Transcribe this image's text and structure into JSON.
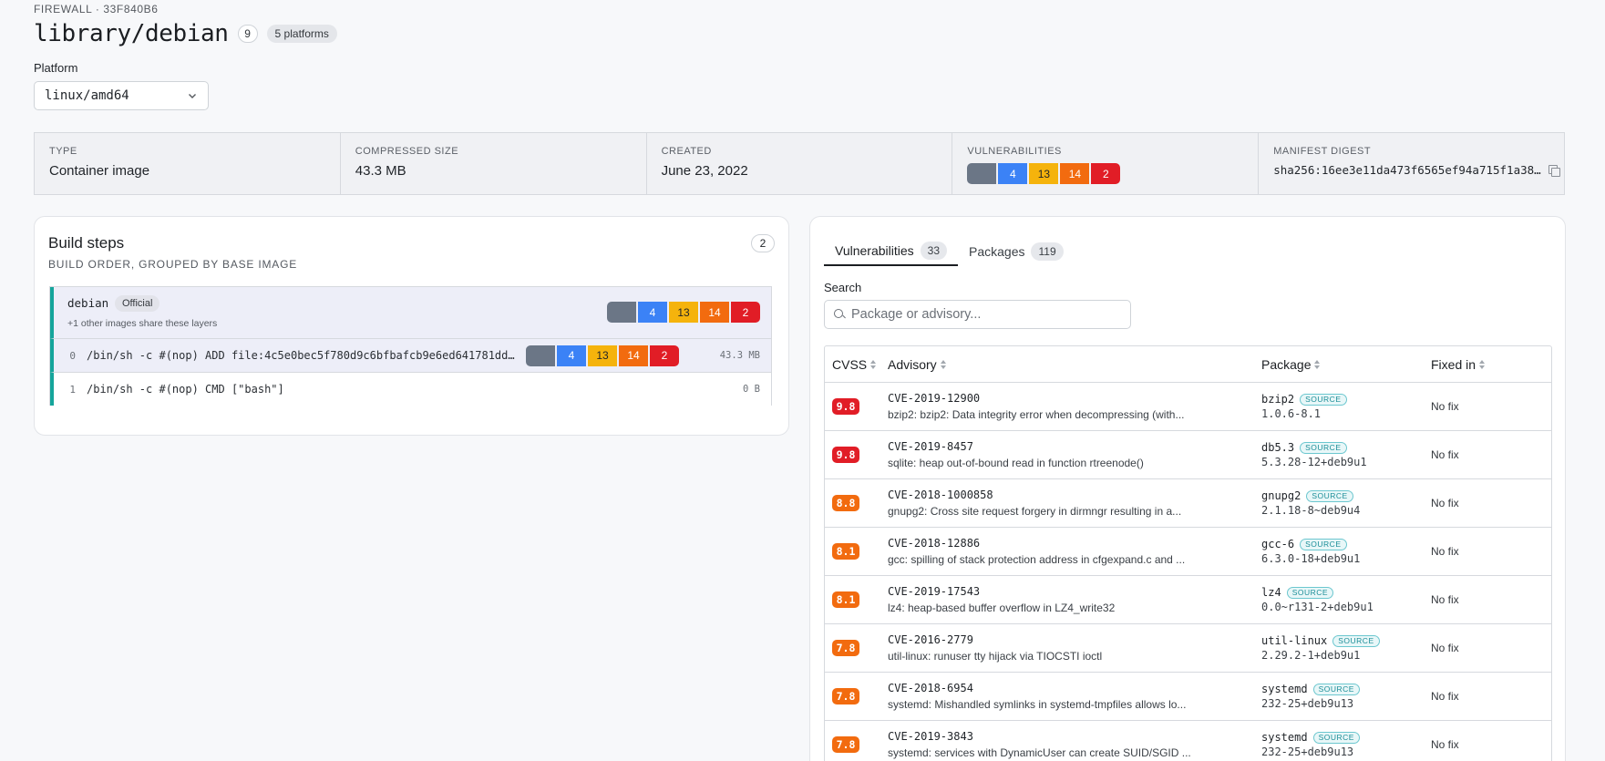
{
  "header": {
    "breadcrumb": "FIREWALL · 33F840B6",
    "title": "library/debian",
    "tag_count": "9",
    "platforms_badge": "5 platforms",
    "platform_label": "Platform",
    "platform_value": "linux/amd64"
  },
  "summary": {
    "type_label": "TYPE",
    "type_value": "Container image",
    "size_label": "COMPRESSED SIZE",
    "size_value": "43.3 MB",
    "created_label": "CREATED",
    "created_value": "June 23, 2022",
    "vulns_label": "VULNERABILITIES",
    "vulns": {
      "unknown": "",
      "low": "4",
      "medium": "13",
      "high": "14",
      "critical": "2"
    },
    "digest_label": "MANIFEST DIGEST",
    "digest_value": "sha256:16ee3e11da473f6565ef94a715f1a38…"
  },
  "colors": {
    "unknown": "#6b7686",
    "low": "#3b82f6",
    "medium": "#f5b30c",
    "high": "#f26b0f",
    "critical": "#e11d26",
    "accent": "#15a59b"
  },
  "build": {
    "title": "Build steps",
    "subtitle": "BUILD ORDER, GROUPED BY BASE IMAGE",
    "count": "2",
    "base": {
      "name": "debian",
      "badge": "Official",
      "note": "+1 other images share these layers",
      "vulns": {
        "unknown": "",
        "low": "4",
        "medium": "13",
        "high": "14",
        "critical": "2"
      }
    },
    "layers": [
      {
        "index": "0",
        "command": "/bin/sh -c #(nop) ADD file:4c5e0bec5f780d9c6bfbafcb9e6ed641781dd…",
        "size": "43.3 MB",
        "vulns": {
          "unknown": "",
          "low": "4",
          "medium": "13",
          "high": "14",
          "critical": "2"
        }
      },
      {
        "index": "1",
        "command": "/bin/sh -c #(nop) CMD [\"bash\"]",
        "size": "0 B"
      }
    ]
  },
  "vulnerabilities_panel": {
    "tabs": [
      {
        "label": "Vulnerabilities",
        "count": "33"
      },
      {
        "label": "Packages",
        "count": "119"
      }
    ],
    "search_label": "Search",
    "search_placeholder": "Package or advisory...",
    "columns": {
      "cvss": "CVSS",
      "advisory": "Advisory",
      "package": "Package",
      "fixed": "Fixed in"
    },
    "source_tag": "SOURCE",
    "rows": [
      {
        "score": "9.8",
        "severity": "critical",
        "id": "CVE-2019-12900",
        "desc": "bzip2: bzip2: Data integrity error when decompressing (with...",
        "pkg": "bzip2",
        "ver": "1.0.6-8.1",
        "fixed": "No fix"
      },
      {
        "score": "9.8",
        "severity": "critical",
        "id": "CVE-2019-8457",
        "desc": "sqlite: heap out-of-bound read in function rtreenode()",
        "pkg": "db5.3",
        "ver": "5.3.28-12+deb9u1",
        "fixed": "No fix"
      },
      {
        "score": "8.8",
        "severity": "high",
        "id": "CVE-2018-1000858",
        "desc": "gnupg2: Cross site request forgery in dirmngr resulting in a...",
        "pkg": "gnupg2",
        "ver": "2.1.18-8~deb9u4",
        "fixed": "No fix"
      },
      {
        "score": "8.1",
        "severity": "high",
        "id": "CVE-2018-12886",
        "desc": "gcc: spilling of stack protection address in cfgexpand.c and ...",
        "pkg": "gcc-6",
        "ver": "6.3.0-18+deb9u1",
        "fixed": "No fix"
      },
      {
        "score": "8.1",
        "severity": "high",
        "id": "CVE-2019-17543",
        "desc": "lz4: heap-based buffer overflow in LZ4_write32",
        "pkg": "lz4",
        "ver": "0.0~r131-2+deb9u1",
        "fixed": "No fix"
      },
      {
        "score": "7.8",
        "severity": "high",
        "id": "CVE-2016-2779",
        "desc": "util-linux: runuser tty hijack via TIOCSTI ioctl",
        "pkg": "util-linux",
        "ver": "2.29.2-1+deb9u1",
        "fixed": "No fix"
      },
      {
        "score": "7.8",
        "severity": "high",
        "id": "CVE-2018-6954",
        "desc": "systemd: Mishandled symlinks in systemd-tmpfiles allows lo...",
        "pkg": "systemd",
        "ver": "232-25+deb9u13",
        "fixed": "No fix"
      },
      {
        "score": "7.8",
        "severity": "high",
        "id": "CVE-2019-3843",
        "desc": "systemd: services with DynamicUser can create SUID/SGID ...",
        "pkg": "systemd",
        "ver": "232-25+deb9u13",
        "fixed": "No fix"
      }
    ]
  }
}
